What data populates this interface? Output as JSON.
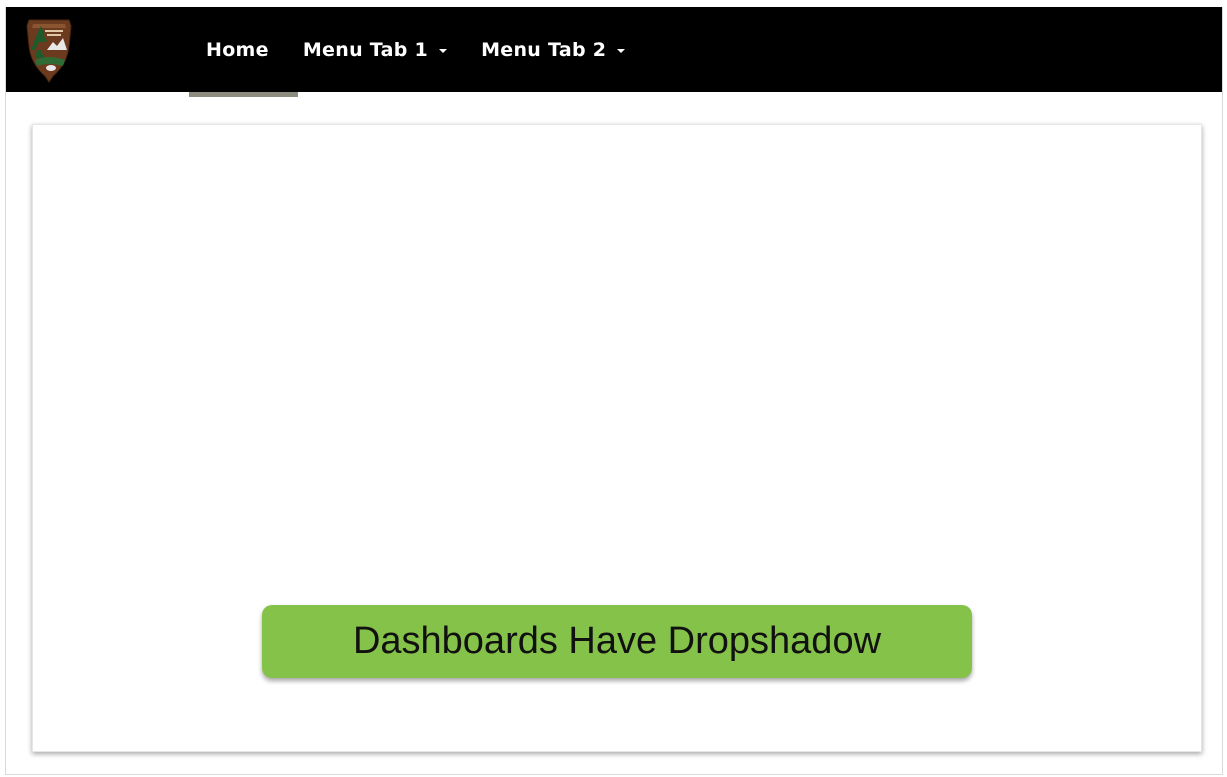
{
  "nav": {
    "logo_icon": "nps-arrowhead-logo-icon",
    "items": [
      {
        "label": "Home",
        "has_dropdown": false
      },
      {
        "label": "Menu Tab 1",
        "has_dropdown": true
      },
      {
        "label": "Menu Tab 2",
        "has_dropdown": true
      }
    ],
    "active_index": 0,
    "background_color": "#000000",
    "active_indicator_color": "#8c8c7f"
  },
  "dashboard": {
    "callout_text": "Dashboards Have Dropshadow",
    "callout_color": "#85c24a"
  }
}
